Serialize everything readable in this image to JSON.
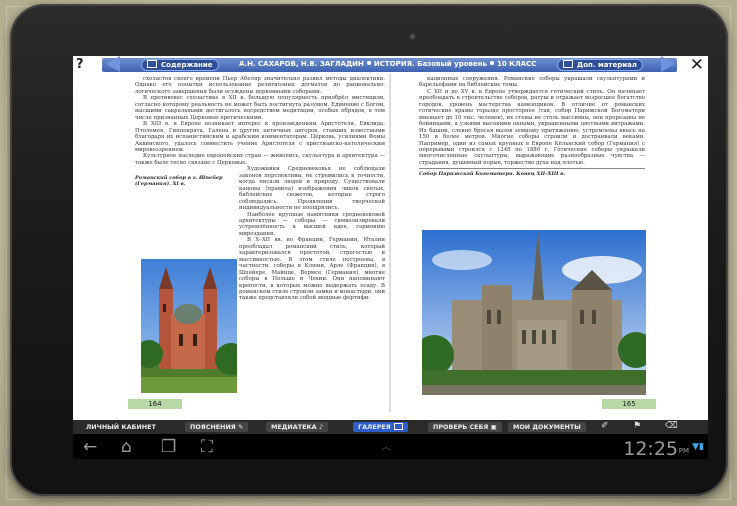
{
  "topbar": {
    "help": "?",
    "contents_label": "Содержание",
    "authors": "А.Н. САХАРОВ, Н.В. ЗАГЛАДИН",
    "subject": "ИСТОРИЯ. Базовый уровень",
    "grade": "10 КЛАСС",
    "extra_label": "Доп. материал",
    "close": "✕"
  },
  "left_page": {
    "paragraphs": [
      "схоластов своего времени Пьер Абеляр значительно развил методы диалектики. Однако его попытки использование религиозных догматов до рационально-логического завершения были осуждены церковными соборами.",
      "В противовес схоластике в XII в. большую популярность приобрёл мистицизм, согласно которому реальность не может быть постигнута разумом. Единение с Богом, высшими сакральными достигалось посредством медитации, особых обрядов, в том числе признанных Церковью еретическими.",
      "В XIII в. в Европе возникает интерес к произведениям Аристотеля, Евклида, Птолемея, Гиппократа, Галена и других античных авторов, ставших известными благодаря их испанистийским и арабским комментаторам. Церковь, усилиями Фомы Аквинского, удалось совместить учение Аристотеля с христианско-католическим мировоззрением.",
      "Культурное наследие европейских стран — живопись, скульптура и архитектура — также было тесно связано с Церковью.",
      "Художники Средневековья не соблюдали законов перспективы, не стремились к точности, когда писали людей и природу. Существовали каноны (правила) изображения ликов святых, библейских сюжетов, которые строго соблюдались. Проявления творческой индивидуальности не поощрялись.",
      "Наиболее крупные памятники средневековой архитектуры — соборы — символизировали устремлённость к высшей идее, гармонию мироздания.",
      "В X–XII вв. во Франции, Германии, Италии преобладал романский стиль, который характеризовался простотой, строгостью и массивностью. В этом стиле построены, в частности, соборы в Клюни, Арле (Франция), в Шпейере, Майнце, Вормсе (Германия), многие соборы в Польше и Чехии. Они напоминают крепости, в которых можно выдержать осаду. В романском стиле строили замки и монастыри, они также представляли собой мощные фортифи-"
    ],
    "caption": "Романский собор в г. Шпейер (Германия). XI в.",
    "page_number": "164"
  },
  "right_page": {
    "paragraphs": [
      "кационные сооружения. Романские соборы украшали скульптурами и барельефами на библейские темы.",
      "С XII и до XV в. в Европе утверждается готический стиль. Он начинает преобладать в строительстве соборов, ратуш и отражает возросшее богатство городов, уровень мастерства каменщиков. В отличие от романских готические храмы гораздо просторнее (так, собор Парижской Богоматери вмещает до 10 тыс. человек), их стены не столь массивны, они прорезаны не бойницами, а узкими высокими окнами, украшенными цветными витражами. Их башни, словно бросая вызов земному притяжению, устремлены ввысь на 150 и более метров. Многие соборы строили и достраивали веками. Например, один из самых крупных в Европе Кёльнский собор (Германия) с перерывами строился с 1248 по 1880 г. Готические соборы украшали многочисленные скульптуры, выражающие разнообразные чувства — страдания, душевный порыв, торжество духа над плотью."
    ],
    "caption": "Собор Парижской Богоматери. Конец XII–XIII в.",
    "page_number": "165"
  },
  "bottombar": {
    "tabs": [
      {
        "label": "ЛИЧНЫЙ КАБИНЕТ"
      },
      {
        "label": "ПОЯСНЕНИЯ"
      },
      {
        "label": "МЕДИАТЕКА"
      },
      {
        "label": "ГАЛЕРЕЯ"
      },
      {
        "label": "ПРОВЕРЬ СЕБЯ"
      },
      {
        "label": "МОИ ДОКУМЕНТЫ"
      }
    ]
  },
  "system": {
    "time": "12:25",
    "ampm": "PM"
  },
  "colors": {
    "toolbar_blue": "#3f62b0",
    "active_tab": "#2d5ec9",
    "page_number_bg": "#b8d9a6"
  }
}
